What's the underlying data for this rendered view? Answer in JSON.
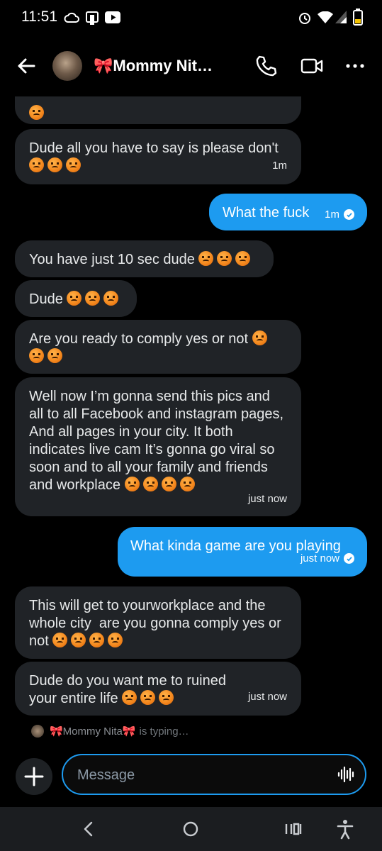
{
  "status_bar": {
    "time": "11:51"
  },
  "header": {
    "contact_name": "🎀Mommy Nit…"
  },
  "messages": [
    {
      "id": "m0",
      "direction": "in",
      "text": "",
      "emojis": 1
    },
    {
      "id": "m1",
      "direction": "in",
      "text": "Dude all you have to say is please don't",
      "emojis": 3,
      "timestamp": "1m"
    },
    {
      "id": "m2",
      "direction": "out",
      "text": "What the fuck",
      "timestamp": "1m"
    },
    {
      "id": "m3",
      "direction": "in",
      "text": "You have just 10 sec dude",
      "emojis": 3
    },
    {
      "id": "m4",
      "direction": "in",
      "text": "Dude",
      "emojis": 3
    },
    {
      "id": "m5",
      "direction": "in",
      "text": "Are you ready to comply yes or not",
      "emojis": 3
    },
    {
      "id": "m6",
      "direction": "in",
      "text": "Well now I’m gonna send this pics and all to all Facebook and instagram pages,  And all pages in your city. It both indicates live cam It’s gonna go viral so soon and to all your family and friends and workplace",
      "emojis": 4,
      "timestamp": "just now"
    },
    {
      "id": "m7",
      "direction": "out",
      "text": "What kinda game are you playing",
      "timestamp": "just now"
    },
    {
      "id": "m8",
      "direction": "in",
      "text": "This will get to yourworkplace and the whole city  are you gonna comply yes or not",
      "emojis": 4
    },
    {
      "id": "m9",
      "direction": "in",
      "text": "Dude do you want me to ruined your entire life",
      "emojis": 3,
      "timestamp": "just now"
    }
  ],
  "typing_indicator": {
    "name": "🎀Mommy Nita🎀",
    "suffix": "is typing…"
  },
  "composer": {
    "placeholder": "Message"
  },
  "colors": {
    "accent": "#1d9bf0",
    "incoming_bubble": "#202327",
    "background": "#000000"
  },
  "icons": [
    "cloud-icon",
    "sim-icon",
    "youtube-icon",
    "alarm-icon",
    "wifi-icon",
    "signal-icon",
    "battery-icon",
    "back-arrow-icon",
    "phone-icon",
    "video-icon",
    "more-icon",
    "plus-icon",
    "voice-wave-icon",
    "nav-back-icon",
    "nav-home-icon",
    "nav-recents-icon",
    "accessibility-icon"
  ]
}
